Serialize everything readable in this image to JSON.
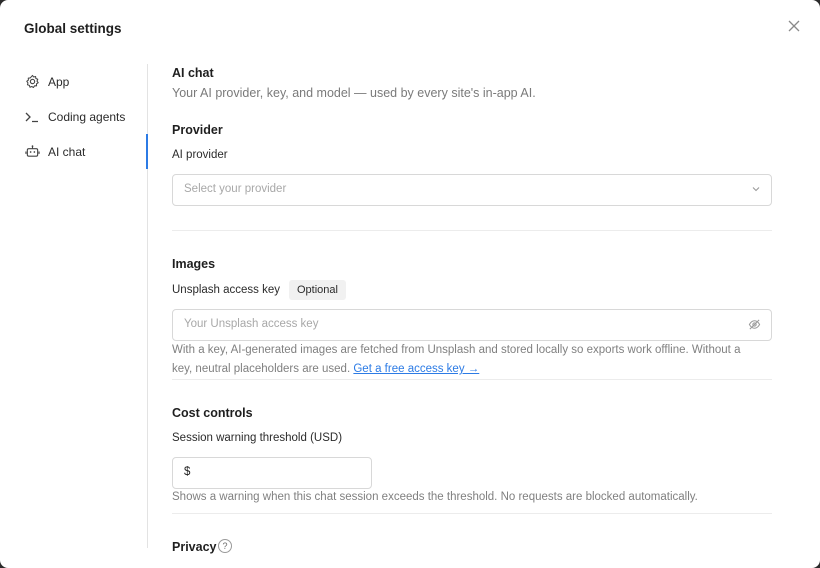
{
  "dialog": {
    "title": "Global settings"
  },
  "sidebar": {
    "items": [
      {
        "label": "App",
        "icon": "gear-icon",
        "active": false
      },
      {
        "label": "Coding agents",
        "icon": "terminal-icon",
        "active": false
      },
      {
        "label": "AI chat",
        "icon": "robot-icon",
        "active": true
      }
    ],
    "accent_color": "#2c7be5"
  },
  "page": {
    "title": "AI chat",
    "subtitle": "Your AI provider, key, and model — used by every site's in-app AI."
  },
  "provider": {
    "heading": "Provider",
    "label": "AI provider",
    "placeholder": "Select your provider"
  },
  "images": {
    "heading": "Images",
    "label": "Unsplash access key",
    "badge": "Optional",
    "placeholder": "Your Unsplash access key",
    "help_line1": "With a key, AI-generated images are fetched from Unsplash and stored locally so exports work offline. Without a",
    "help_line2": "key, neutral placeholders are used.",
    "link": "Get a free access key →"
  },
  "cost": {
    "heading": "Cost controls",
    "label": "Session warning threshold (USD)",
    "currency": "$",
    "help": "Shows a warning when this chat session exceeds the threshold. No requests are blocked automatically."
  },
  "privacy": {
    "heading": "Privacy",
    "help_glyph": "?"
  }
}
